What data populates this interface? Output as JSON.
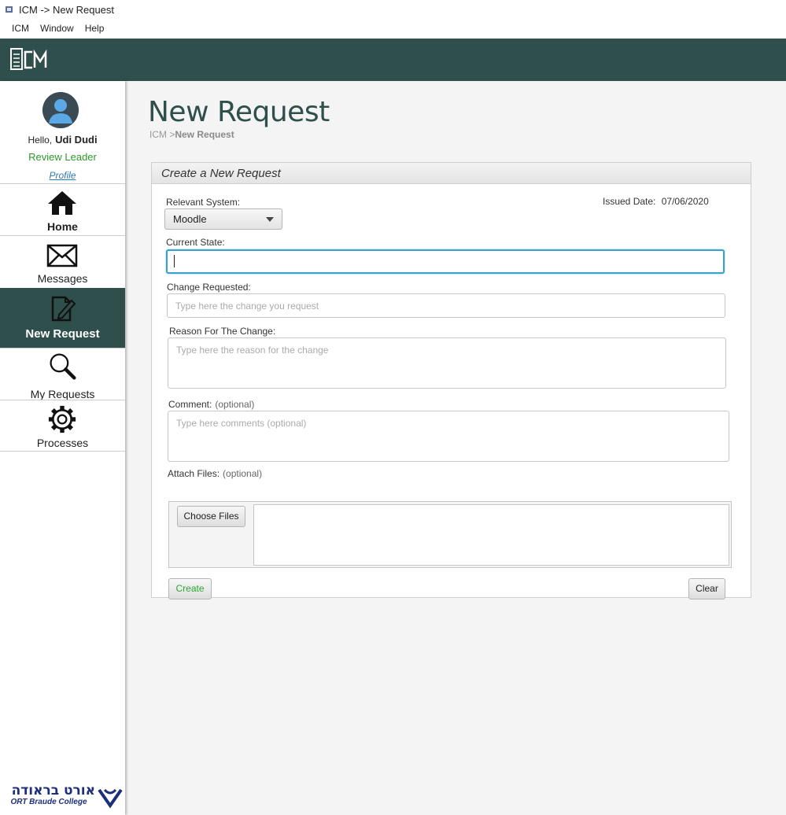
{
  "window": {
    "title": "ICM -> New Request"
  },
  "menu": [
    "ICM",
    "Window",
    "Help"
  ],
  "header": {
    "logo_icon": "icm-logo-icon"
  },
  "user": {
    "greeting": "Hello,",
    "name": "Udi Dudi",
    "role": "Review Leader",
    "profile_link": "Profile"
  },
  "nav": [
    {
      "label": "Home",
      "icon": "home-icon",
      "active": false
    },
    {
      "label": "Messages",
      "icon": "envelope-icon",
      "active": false
    },
    {
      "label": "New Request",
      "icon": "edit-document-icon",
      "active": true
    },
    {
      "label": "My Requests",
      "icon": "magnifier-icon",
      "active": false
    },
    {
      "label": "Processes",
      "icon": "gear-icon",
      "active": false
    }
  ],
  "college": {
    "name_hebrew": "אורט בראודה",
    "name_english": "ORT Braude College"
  },
  "page": {
    "title": "New Request",
    "breadcrumb_root": "ICM >",
    "breadcrumb_current": "New Request"
  },
  "form": {
    "panel_title": "Create a New Request",
    "relevant_system_label": "Relevant System:",
    "relevant_system_value": "Moodle",
    "issued_date_label": "Issued Date:",
    "issued_date_value": "07/06/2020",
    "current_state_label": "Current State:",
    "current_state_value": "",
    "change_requested_label": "Change Requested:",
    "change_requested_placeholder": "Type here the change you request",
    "reason_label": "Reason For The Change:",
    "reason_placeholder": "Type here the reason for the change",
    "comment_label": "Comment:",
    "comment_optional": "(optional)",
    "comment_placeholder": "Type here comments (optional)",
    "attach_label": "Attach Files:",
    "attach_optional": "(optional)",
    "choose_files_label": "Choose Files",
    "create_label": "Create",
    "clear_label": "Clear"
  },
  "colors": {
    "header": "#2f4f4c",
    "role": "#2b9a2b",
    "create": "#2ea82e",
    "focus": "#3aa0d0"
  }
}
